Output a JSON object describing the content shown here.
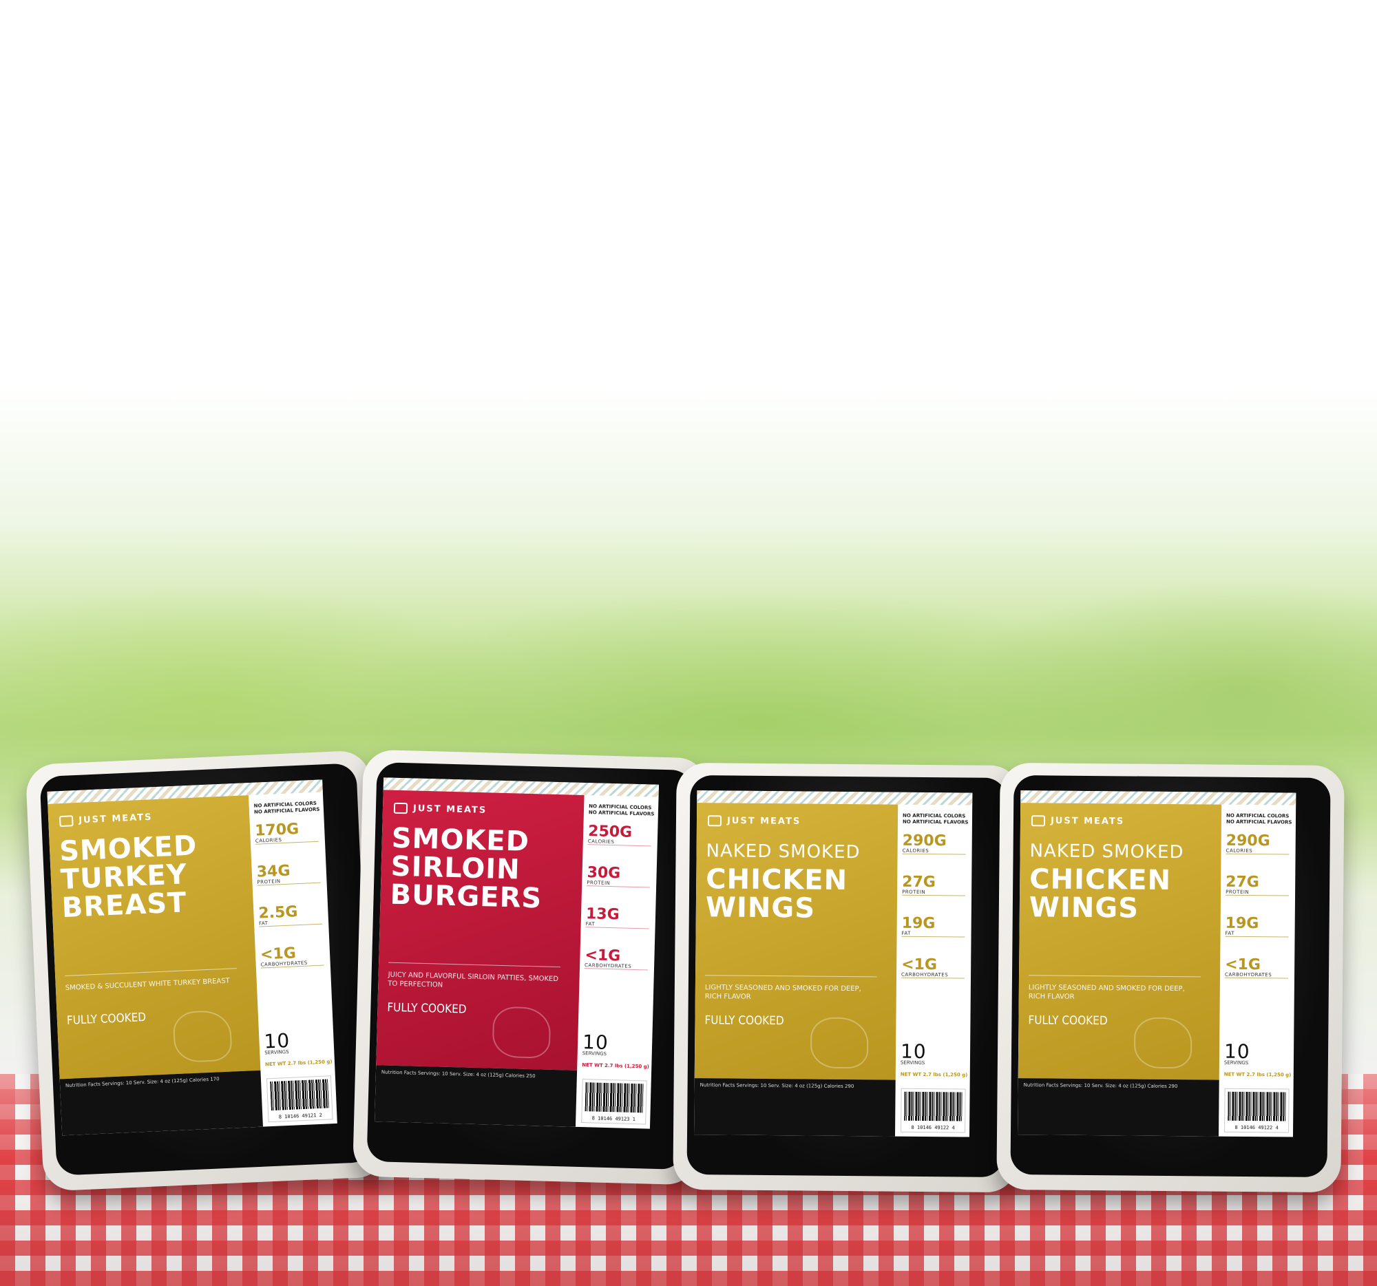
{
  "products": [
    {
      "brand": "JUST MEATS",
      "title_lines": [
        "SMOKED",
        "TURKEY",
        "BREAST"
      ],
      "claims": [
        "NO ARTIFICIAL COLORS",
        "NO ARTIFICIAL FLAVORS"
      ],
      "stats": [
        {
          "value": "170G",
          "label": "CALORIES"
        },
        {
          "value": "34G",
          "label": "PROTEIN"
        },
        {
          "value": "2.5G",
          "label": "FAT"
        },
        {
          "value": "<1G",
          "label": "CARBOHYDRATES"
        }
      ],
      "description": "SMOKED & SUCCULENT WHITE TURKEY BREAST",
      "cooked": "FULLY COOKED",
      "servings": "10",
      "servings_label": "SERVINGS",
      "net_weight": "NET WT 2.7 lbs (1,250 g)",
      "facts": "Nutrition Facts Servings: 10 Serv. Size: 4 oz (125g) Calories 170",
      "barcode": "8 10146 49121 2",
      "color": "#c9a62c"
    },
    {
      "brand": "JUST MEATS",
      "title_lines": [
        "SMOKED",
        "SIRLOIN",
        "BURGERS"
      ],
      "claims": [
        "NO ARTIFICIAL COLORS",
        "NO ARTIFICIAL FLAVORS"
      ],
      "stats": [
        {
          "value": "250G",
          "label": "CALORIES"
        },
        {
          "value": "30G",
          "label": "PROTEIN"
        },
        {
          "value": "13G",
          "label": "FAT"
        },
        {
          "value": "<1G",
          "label": "CARBOHYDRATES"
        }
      ],
      "description": "JUICY AND FLAVORFUL SIRLOIN PATTIES, SMOKED TO PERFECTION",
      "cooked": "FULLY COOKED",
      "servings": "10",
      "servings_label": "SERVINGS",
      "net_weight": "NET WT 2.7 lbs (1,250 g)",
      "facts": "Nutrition Facts Servings: 10 Serv. Size: 4 oz (125g) Calories 250",
      "barcode": "8 10146 49123 1",
      "color": "#c81b3b"
    },
    {
      "brand": "JUST MEATS",
      "title_lines": [
        "NAKED SMOKED",
        "CHICKEN",
        "WINGS"
      ],
      "claims": [
        "NO ARTIFICIAL COLORS",
        "NO ARTIFICIAL FLAVORS"
      ],
      "stats": [
        {
          "value": "290G",
          "label": "CALORIES"
        },
        {
          "value": "27G",
          "label": "PROTEIN"
        },
        {
          "value": "19G",
          "label": "FAT"
        },
        {
          "value": "<1G",
          "label": "CARBOHYDRATES"
        }
      ],
      "description": "LIGHTLY SEASONED AND SMOKED FOR DEEP, RICH FLAVOR",
      "cooked": "FULLY COOKED",
      "servings": "10",
      "servings_label": "SERVINGS",
      "net_weight": "NET WT 2.7 lbs (1,250 g)",
      "facts": "Nutrition Facts Servings: 10 Serv. Size: 4 oz (125g) Calories 290",
      "barcode": "8 10146 49122 4",
      "color": "#c9a62c"
    },
    {
      "brand": "JUST MEATS",
      "title_lines": [
        "NAKED SMOKED",
        "CHICKEN",
        "WINGS"
      ],
      "claims": [
        "NO ARTIFICIAL COLORS",
        "NO ARTIFICIAL FLAVORS"
      ],
      "stats": [
        {
          "value": "290G",
          "label": "CALORIES"
        },
        {
          "value": "27G",
          "label": "PROTEIN"
        },
        {
          "value": "19G",
          "label": "FAT"
        },
        {
          "value": "<1G",
          "label": "CARBOHYDRATES"
        }
      ],
      "description": "LIGHTLY SEASONED AND SMOKED FOR DEEP, RICH FLAVOR",
      "cooked": "FULLY COOKED",
      "servings": "10",
      "servings_label": "SERVINGS",
      "net_weight": "NET WT 2.7 lbs (1,250 g)",
      "facts": "Nutrition Facts Servings: 10 Serv. Size: 4 oz (125g) Calories 290",
      "barcode": "8 10146 49122 4",
      "color": "#c9a62c"
    }
  ]
}
